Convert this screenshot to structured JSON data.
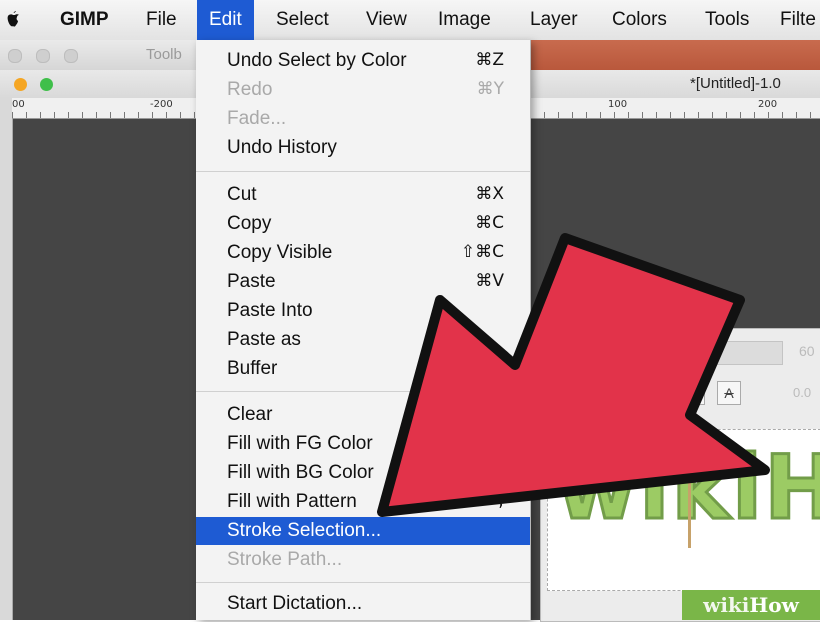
{
  "menubar": {
    "app": "GIMP",
    "items": [
      "File",
      "Edit",
      "Select",
      "View",
      "Image",
      "Layer",
      "Colors",
      "Tools",
      "Filte"
    ],
    "active": "Edit"
  },
  "toolbox": {
    "title": "Toolb"
  },
  "image_window": {
    "title": "*[Untitled]-1.0"
  },
  "ruler": {
    "labels": [
      "00",
      "-200",
      "100",
      "200"
    ]
  },
  "edit_menu": {
    "groups": [
      [
        {
          "label": "Undo Select by Color",
          "shortcut": "⌘Z",
          "state": "enabled"
        },
        {
          "label": "Redo",
          "shortcut": "⌘Y",
          "state": "disabled"
        },
        {
          "label": "Fade...",
          "shortcut": "",
          "state": "disabled"
        },
        {
          "label": "Undo History",
          "shortcut": "",
          "state": "enabled"
        }
      ],
      [
        {
          "label": "Cut",
          "shortcut": "⌘X",
          "state": "enabled"
        },
        {
          "label": "Copy",
          "shortcut": "⌘C",
          "state": "enabled"
        },
        {
          "label": "Copy Visible",
          "shortcut": "⇧⌘C",
          "state": "enabled"
        },
        {
          "label": "Paste",
          "shortcut": "⌘V",
          "state": "enabled"
        },
        {
          "label": "Paste Into",
          "shortcut": "",
          "state": "enabled"
        },
        {
          "label": "Paste as",
          "shortcut": "",
          "state": "enabled"
        },
        {
          "label": "Buffer",
          "shortcut": "",
          "state": "enabled"
        }
      ],
      [
        {
          "label": "Clear",
          "shortcut": "",
          "state": "enabled"
        },
        {
          "label": "Fill with FG Color",
          "shortcut": "",
          "state": "enabled"
        },
        {
          "label": "Fill with BG Color",
          "shortcut": "",
          "state": "enabled"
        },
        {
          "label": "Fill with Pattern",
          "shortcut": ";",
          "state": "enabled"
        },
        {
          "label": "Stroke Selection...",
          "shortcut": "",
          "state": "highlighted"
        },
        {
          "label": "Stroke Path...",
          "shortcut": "",
          "state": "disabled"
        }
      ],
      [
        {
          "label": "Start Dictation...",
          "shortcut": "",
          "state": "enabled"
        }
      ]
    ]
  },
  "text_dialog": {
    "size_value": "60",
    "offset_value": "0.0",
    "format_icons": [
      "italic-icon",
      "underline-icon",
      "strikethrough-icon"
    ]
  },
  "canvas": {
    "text": "wikiH"
  },
  "watermark": {
    "part1": "wiki",
    "part2": "How"
  },
  "colors": {
    "accent": "#1e5bd3",
    "arrow": "#e2334a",
    "wiki_green": "#8bc34a"
  }
}
